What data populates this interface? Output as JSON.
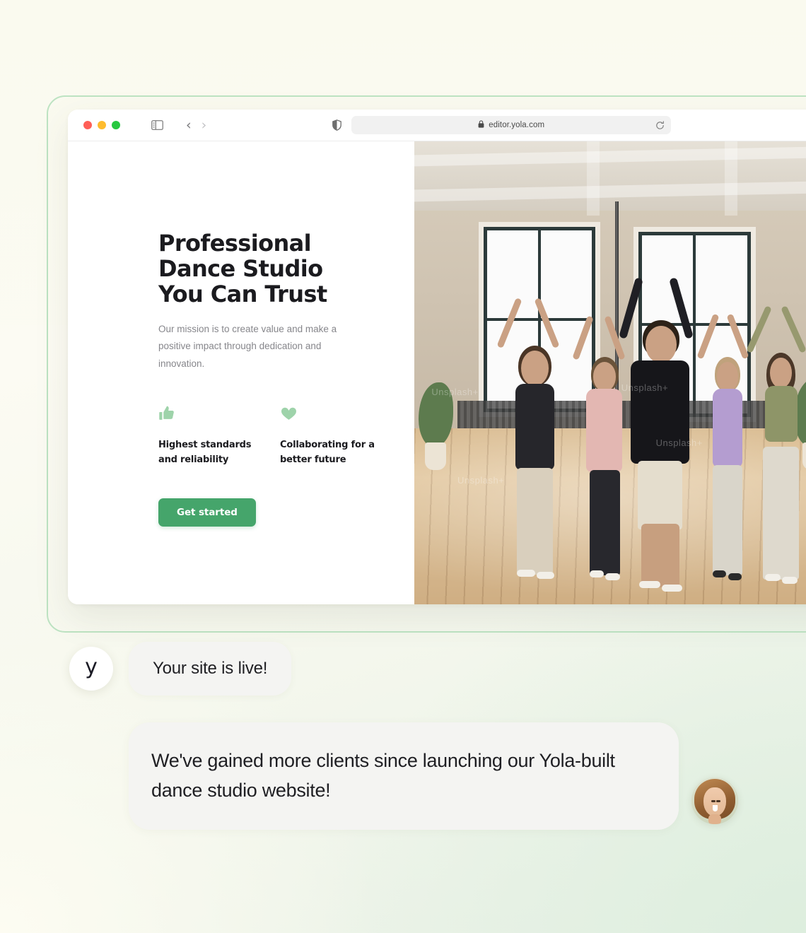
{
  "browser": {
    "traffic_lights": [
      "close",
      "minimize",
      "maximize"
    ],
    "sidebar_icon": "sidebar-toggle-icon",
    "back_glyph": "‹",
    "forward_glyph": "›",
    "shield_glyph": "◗",
    "lock_glyph": "🔒",
    "url": "editor.yola.com",
    "reload_glyph": "↻"
  },
  "site": {
    "hero": {
      "title_lines": [
        "Professional",
        "Dance Studio",
        "You Can Trust"
      ],
      "subtitle": "Our mission is to create value and make a positive impact through dedication and innovation.",
      "cta_label": "Get started",
      "features": [
        {
          "icon": "thumbs-up-icon",
          "label": "Highest standards and reliability"
        },
        {
          "icon": "heart-icon",
          "label": "Collaborating for a better future"
        }
      ]
    },
    "photo": {
      "alt": "dance-studio-class-photo",
      "watermarks": [
        "Unsplash+",
        "Unsplash+",
        "Unsplash+",
        "Unsplash+"
      ]
    }
  },
  "chat": {
    "brand_avatar_letter": "y",
    "message_1": "Your site is live!",
    "message_2": "We've gained more clients since launching our Yola-built dance studio website!",
    "person_avatar": "customer-photo-avatar"
  },
  "colors": {
    "accent_green": "#45a56b",
    "icon_green": "#9ed3aa",
    "frame_green": "#bde3c2",
    "bubble_grey": "#f4f4f2",
    "text_dark": "#1b1b1f",
    "text_muted": "#86868b"
  }
}
